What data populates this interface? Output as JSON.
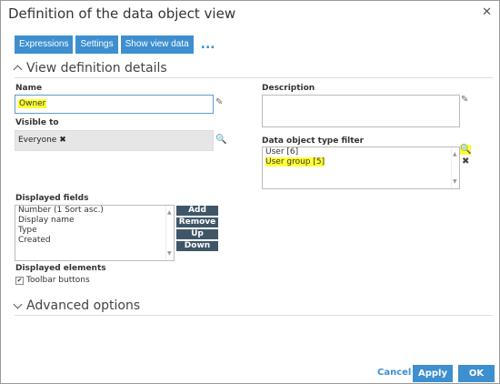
{
  "dialog": {
    "title": "Definition of the data object view"
  },
  "toolbar": {
    "expressions": "Expressions",
    "settings": "Settings",
    "show_view_data": "Show view data",
    "more": "..."
  },
  "sections": {
    "view_definition": "View definition details",
    "advanced": "Advanced options"
  },
  "form": {
    "name_label": "Name",
    "name_value": "Owner",
    "description_label": "Description",
    "description_value": "",
    "visible_to_label": "Visible to",
    "visible_to_tag": "Everyone",
    "type_filter_label": "Data object type filter",
    "type_filter_items": [
      "User [6]",
      "User group [5]"
    ],
    "displayed_fields_label": "Displayed fields",
    "displayed_fields": [
      "Number (1 Sort asc.)",
      "Display name",
      "Type",
      "Created"
    ],
    "field_buttons": {
      "add": "Add",
      "remove": "Remove",
      "up": "Up",
      "down": "Down"
    },
    "displayed_elements_label": "Displayed elements",
    "toolbar_buttons_label": "Toolbar buttons",
    "toolbar_buttons_checked": true
  },
  "footer": {
    "cancel": "Cancel",
    "apply": "Apply",
    "ok": "OK"
  },
  "colors": {
    "accent": "#3d8fcf",
    "highlight": "#ffff33",
    "dark_button": "#3f5668"
  }
}
